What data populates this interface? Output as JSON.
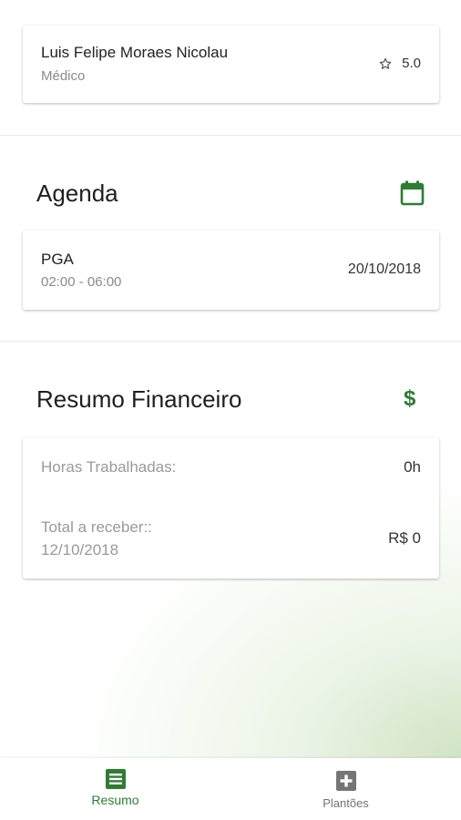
{
  "profile": {
    "name": "Luis Felipe Moraes Nicolau",
    "role": "Médico",
    "rating": "5.0"
  },
  "agenda": {
    "title": "Agenda",
    "item": {
      "title": "PGA",
      "time": "02:00 - 06:00",
      "date": "20/10/2018"
    }
  },
  "finance": {
    "title": "Resumo Financeiro",
    "hours_label": "Horas Trabalhadas:",
    "hours_value": "0h",
    "total_label_line1": "Total a receber::",
    "total_label_line2": "12/10/2018",
    "total_value": "R$ 0"
  },
  "bottom_nav": {
    "items": [
      {
        "label": "Resumo",
        "icon": "list-icon",
        "active": true
      },
      {
        "label": "Plantões",
        "icon": "plus-box-icon",
        "active": false
      }
    ]
  },
  "colors": {
    "accent": "#2e7d32",
    "inactive": "#757575"
  }
}
